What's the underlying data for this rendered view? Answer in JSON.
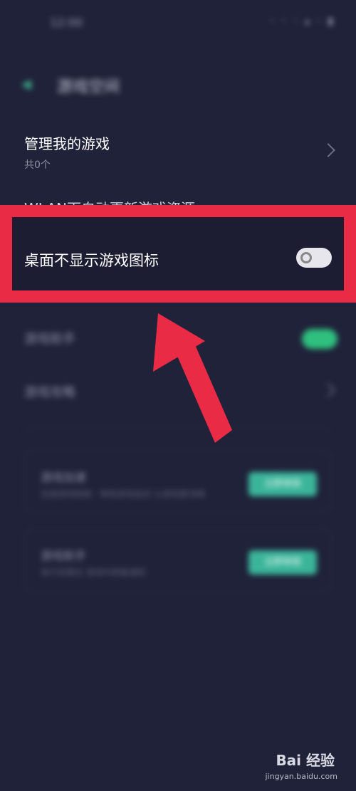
{
  "status_bar": {
    "time": "12:00",
    "icons": "◦ ◦ ◦ ▴ ◦ ▮"
  },
  "header": {
    "back_icon": "back-arrow-icon",
    "title": "游戏空间"
  },
  "settings": {
    "manage_games": {
      "label": "管理我的游戏",
      "sub": "共0个"
    },
    "wlan_update": {
      "label": "WLAN下自动更新游戏资源"
    },
    "hide_icon": {
      "label": "桌面不显示游戏图标",
      "toggle": "off"
    },
    "game_assistant": {
      "label": "游戏助手",
      "toggle": "on"
    },
    "game_guide": {
      "label": "游戏攻略"
    }
  },
  "cards": [
    {
      "title": "游戏加速",
      "desc": "加速游戏网络 · 降低游戏延迟 让游戏更流畅",
      "button": "立即体验"
    },
    {
      "title": "游戏助手",
      "desc": "免打扰模式 游戏时屏蔽通知",
      "button": "立即体验"
    }
  ],
  "colors": {
    "background": "#20223a",
    "highlight": "#ea2b46",
    "toggle_on": "#2fc07f",
    "button": "#3bb59a"
  },
  "watermark": {
    "brand": "Bai 经验",
    "url": "jingyan.baidu.com"
  }
}
